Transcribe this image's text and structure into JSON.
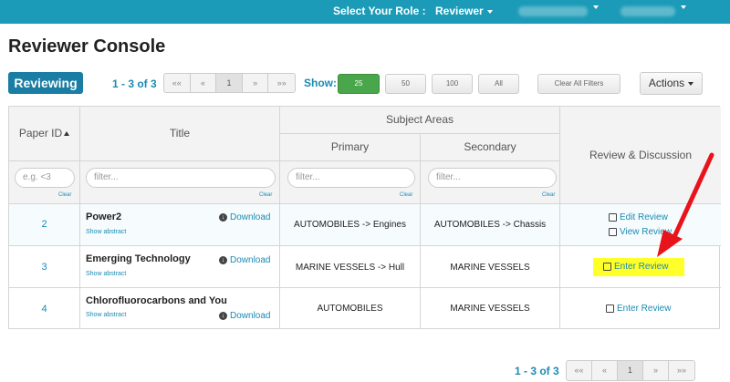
{
  "topbar": {
    "role_label": "Select Your Role :",
    "role_value": "Reviewer"
  },
  "page_title": "Reviewer Console",
  "toolbar": {
    "reviewing": "Reviewing",
    "range": "1 - 3 of 3",
    "pager": [
      "««",
      "«",
      "1",
      "»",
      "»»"
    ],
    "show_label": "Show:",
    "show_options": [
      "25",
      "50",
      "100",
      "All"
    ],
    "clear_filters": "Clear All Filters",
    "actions": "Actions"
  },
  "table": {
    "headers": {
      "paper_id": "Paper ID",
      "title": "Title",
      "subject_areas": "Subject Areas",
      "primary": "Primary",
      "secondary": "Secondary",
      "review": "Review & Discussion"
    },
    "filters": {
      "paper_id_placeholder": "e.g. <3",
      "title_placeholder": "filter...",
      "primary_placeholder": "filter...",
      "secondary_placeholder": "filter...",
      "clear": "Clear"
    },
    "rows": [
      {
        "id": "2",
        "title": "Power2",
        "abstract": "Show abstract",
        "download": "Download",
        "primary": "AUTOMOBILES -> Engines",
        "secondary": "AUTOMOBILES -> Chassis",
        "actions": [
          "Edit Review",
          "View Review"
        ]
      },
      {
        "id": "3",
        "title": "Emerging Technology",
        "abstract": "Show abstract",
        "download": "Download",
        "primary": "MARINE VESSELS -> Hull",
        "secondary": "MARINE VESSELS",
        "actions": [
          "Enter Review"
        ]
      },
      {
        "id": "4",
        "title": "Chlorofluorocarbons and You",
        "abstract": "Show abstract",
        "download": "Download",
        "primary": "AUTOMOBILES",
        "secondary": "MARINE VESSELS",
        "actions": [
          "Enter Review"
        ]
      }
    ]
  },
  "footer": {
    "range": "1 - 3 of 3",
    "pager": [
      "««",
      "«",
      "1",
      "»",
      "»»"
    ]
  },
  "colors": {
    "topbar": "#1b9bb7",
    "accent": "#1a8bb3",
    "highlight": "#ffff2a",
    "annotation_arrow": "#e8141b"
  }
}
